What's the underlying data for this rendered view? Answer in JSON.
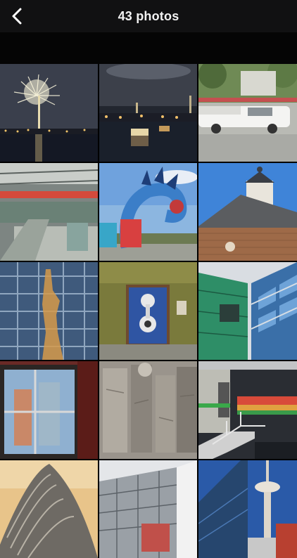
{
  "header": {
    "title": "43 photos",
    "back_icon": "chevron-left-icon"
  },
  "colors": {
    "header_background": "#111112",
    "title_text": "#f2f2f2",
    "page_background": "#000000"
  },
  "photos": [
    {
      "id": 1,
      "subject": "fireworks"
    },
    {
      "id": 2,
      "subject": "harbor-night"
    },
    {
      "id": 3,
      "subject": "white-limousine"
    },
    {
      "id": 4,
      "subject": "station-hall"
    },
    {
      "id": 5,
      "subject": "sea-serpent-sculpture"
    },
    {
      "id": 6,
      "subject": "brick-church"
    },
    {
      "id": 7,
      "subject": "glass-facade-reflection"
    },
    {
      "id": 8,
      "subject": "graffiti-door"
    },
    {
      "id": 9,
      "subject": "modern-green-facade"
    },
    {
      "id": 10,
      "subject": "window-reflection"
    },
    {
      "id": 11,
      "subject": "stone-sculpture"
    },
    {
      "id": 12,
      "subject": "modern-interior-stairs"
    },
    {
      "id": 13,
      "subject": "curved-tower"
    },
    {
      "id": 14,
      "subject": "office-building"
    },
    {
      "id": 15,
      "subject": "tv-tower"
    }
  ]
}
